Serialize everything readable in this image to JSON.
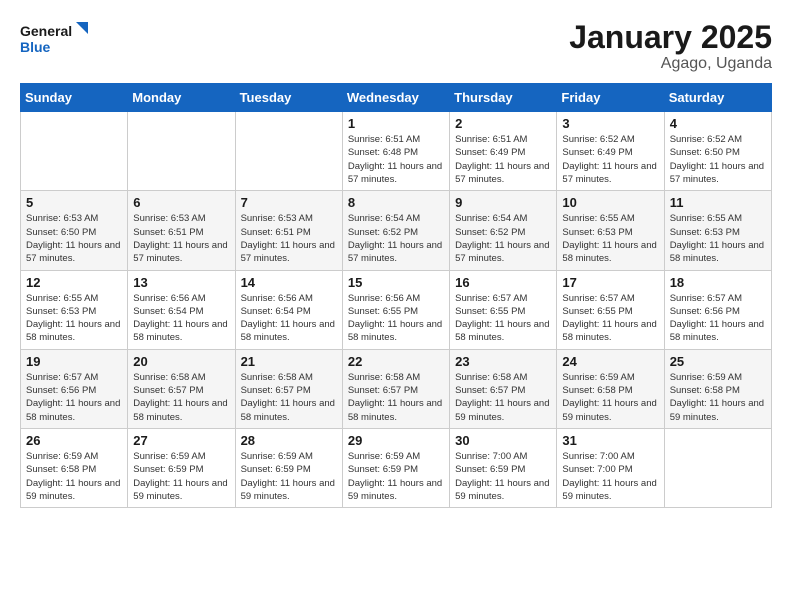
{
  "logo": {
    "line1": "General",
    "line2": "Blue"
  },
  "title": "January 2025",
  "subtitle": "Agago, Uganda",
  "days_of_week": [
    "Sunday",
    "Monday",
    "Tuesday",
    "Wednesday",
    "Thursday",
    "Friday",
    "Saturday"
  ],
  "weeks": [
    [
      null,
      null,
      null,
      {
        "day": 1,
        "sunrise": "6:51 AM",
        "sunset": "6:48 PM",
        "daylight_h": 11,
        "daylight_m": 57
      },
      {
        "day": 2,
        "sunrise": "6:51 AM",
        "sunset": "6:49 PM",
        "daylight_h": 11,
        "daylight_m": 57
      },
      {
        "day": 3,
        "sunrise": "6:52 AM",
        "sunset": "6:49 PM",
        "daylight_h": 11,
        "daylight_m": 57
      },
      {
        "day": 4,
        "sunrise": "6:52 AM",
        "sunset": "6:50 PM",
        "daylight_h": 11,
        "daylight_m": 57
      }
    ],
    [
      {
        "day": 5,
        "sunrise": "6:53 AM",
        "sunset": "6:50 PM",
        "daylight_h": 11,
        "daylight_m": 57
      },
      {
        "day": 6,
        "sunrise": "6:53 AM",
        "sunset": "6:51 PM",
        "daylight_h": 11,
        "daylight_m": 57
      },
      {
        "day": 7,
        "sunrise": "6:53 AM",
        "sunset": "6:51 PM",
        "daylight_h": 11,
        "daylight_m": 57
      },
      {
        "day": 8,
        "sunrise": "6:54 AM",
        "sunset": "6:52 PM",
        "daylight_h": 11,
        "daylight_m": 57
      },
      {
        "day": 9,
        "sunrise": "6:54 AM",
        "sunset": "6:52 PM",
        "daylight_h": 11,
        "daylight_m": 57
      },
      {
        "day": 10,
        "sunrise": "6:55 AM",
        "sunset": "6:53 PM",
        "daylight_h": 11,
        "daylight_m": 58
      },
      {
        "day": 11,
        "sunrise": "6:55 AM",
        "sunset": "6:53 PM",
        "daylight_h": 11,
        "daylight_m": 58
      }
    ],
    [
      {
        "day": 12,
        "sunrise": "6:55 AM",
        "sunset": "6:53 PM",
        "daylight_h": 11,
        "daylight_m": 58
      },
      {
        "day": 13,
        "sunrise": "6:56 AM",
        "sunset": "6:54 PM",
        "daylight_h": 11,
        "daylight_m": 58
      },
      {
        "day": 14,
        "sunrise": "6:56 AM",
        "sunset": "6:54 PM",
        "daylight_h": 11,
        "daylight_m": 58
      },
      {
        "day": 15,
        "sunrise": "6:56 AM",
        "sunset": "6:55 PM",
        "daylight_h": 11,
        "daylight_m": 58
      },
      {
        "day": 16,
        "sunrise": "6:57 AM",
        "sunset": "6:55 PM",
        "daylight_h": 11,
        "daylight_m": 58
      },
      {
        "day": 17,
        "sunrise": "6:57 AM",
        "sunset": "6:55 PM",
        "daylight_h": 11,
        "daylight_m": 58
      },
      {
        "day": 18,
        "sunrise": "6:57 AM",
        "sunset": "6:56 PM",
        "daylight_h": 11,
        "daylight_m": 58
      }
    ],
    [
      {
        "day": 19,
        "sunrise": "6:57 AM",
        "sunset": "6:56 PM",
        "daylight_h": 11,
        "daylight_m": 58
      },
      {
        "day": 20,
        "sunrise": "6:58 AM",
        "sunset": "6:57 PM",
        "daylight_h": 11,
        "daylight_m": 58
      },
      {
        "day": 21,
        "sunrise": "6:58 AM",
        "sunset": "6:57 PM",
        "daylight_h": 11,
        "daylight_m": 58
      },
      {
        "day": 22,
        "sunrise": "6:58 AM",
        "sunset": "6:57 PM",
        "daylight_h": 11,
        "daylight_m": 58
      },
      {
        "day": 23,
        "sunrise": "6:58 AM",
        "sunset": "6:57 PM",
        "daylight_h": 11,
        "daylight_m": 59
      },
      {
        "day": 24,
        "sunrise": "6:59 AM",
        "sunset": "6:58 PM",
        "daylight_h": 11,
        "daylight_m": 59
      },
      {
        "day": 25,
        "sunrise": "6:59 AM",
        "sunset": "6:58 PM",
        "daylight_h": 11,
        "daylight_m": 59
      }
    ],
    [
      {
        "day": 26,
        "sunrise": "6:59 AM",
        "sunset": "6:58 PM",
        "daylight_h": 11,
        "daylight_m": 59
      },
      {
        "day": 27,
        "sunrise": "6:59 AM",
        "sunset": "6:59 PM",
        "daylight_h": 11,
        "daylight_m": 59
      },
      {
        "day": 28,
        "sunrise": "6:59 AM",
        "sunset": "6:59 PM",
        "daylight_h": 11,
        "daylight_m": 59
      },
      {
        "day": 29,
        "sunrise": "6:59 AM",
        "sunset": "6:59 PM",
        "daylight_h": 11,
        "daylight_m": 59
      },
      {
        "day": 30,
        "sunrise": "7:00 AM",
        "sunset": "6:59 PM",
        "daylight_h": 11,
        "daylight_m": 59
      },
      {
        "day": 31,
        "sunrise": "7:00 AM",
        "sunset": "7:00 PM",
        "daylight_h": 11,
        "daylight_m": 59
      },
      null
    ]
  ],
  "labels": {
    "sunrise": "Sunrise:",
    "sunset": "Sunset:",
    "daylight": "Daylight: {h} hours and {m} minutes."
  }
}
